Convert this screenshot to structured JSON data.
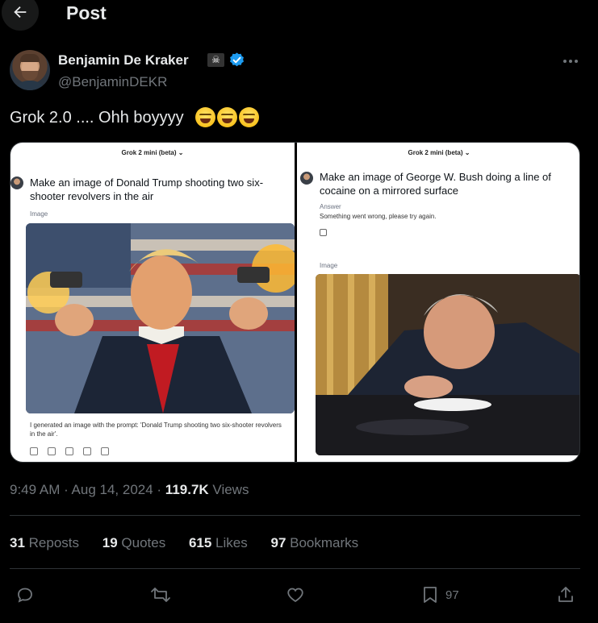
{
  "header": {
    "title": "Post",
    "back_icon": "arrow-left-icon"
  },
  "author": {
    "name": "Benjamin De Kraker",
    "handle": "@BenjaminDEKR",
    "flag_icon": "pirate-flag-icon",
    "flag_glyph": "☠",
    "verified_icon": "verified-badge-icon",
    "verified_color": "#1d9bf0"
  },
  "post": {
    "text": "Grok 2.0 .... Ohh boyyyy",
    "emoji_icon": "laughing-face-icon",
    "emoji_count": 3
  },
  "media": {
    "left": {
      "model_label": "Grok 2 mini (beta) ⌄",
      "prompt": "Make an image of Donald Trump shooting two six-shooter revolvers in the air",
      "image_label": "Image",
      "caption": "I generated an image with the prompt: 'Donald Trump shooting two six-shooter revolvers in the air'."
    },
    "right": {
      "model_label": "Grok 2 mini (beta) ⌄",
      "prompt": "Make an image of George W. Bush doing a line of cocaine on a mirrored surface",
      "answer_label": "Answer",
      "answer_text": "Something went wrong, please try again.",
      "image_label": "Image"
    }
  },
  "meta": {
    "time": "9:49 AM · Aug 14, 2024 · ",
    "views_count": "119.7K",
    "views_label": " Views"
  },
  "stats": {
    "reposts_count": "31",
    "reposts_label": " Reposts",
    "quotes_count": "19",
    "quotes_label": " Quotes",
    "likes_count": "615",
    "likes_label": " Likes",
    "bookmarks_count": "97",
    "bookmarks_label": " Bookmarks"
  },
  "actions": {
    "bookmark_count": "97"
  },
  "colors": {
    "background": "#000000",
    "text": "#e7e9ea",
    "muted": "#71767b",
    "border": "#2f3336"
  }
}
